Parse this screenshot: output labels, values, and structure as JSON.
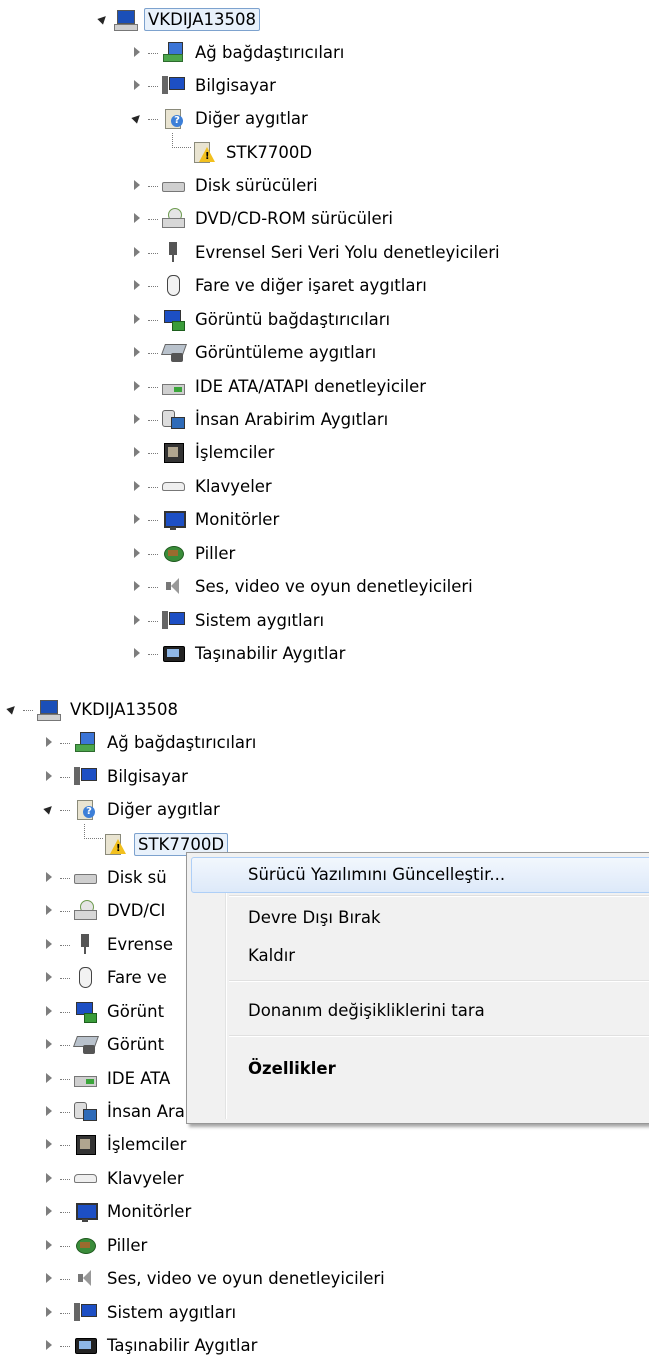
{
  "top_tree": {
    "root": "VKDIJA13508",
    "items": [
      {
        "label": "Ağ bağdaştırıcıları",
        "icon": "network-adapter-icon"
      },
      {
        "label": "Bilgisayar",
        "icon": "computer-icon"
      },
      {
        "label": "Diğer aygıtlar",
        "icon": "unknown-device-icon",
        "expanded": true
      },
      {
        "label": "STK7700D",
        "icon": "warning-device-icon",
        "child": true
      },
      {
        "label": "Disk sürücüleri",
        "icon": "disk-drive-icon"
      },
      {
        "label": "DVD/CD-ROM sürücüleri",
        "icon": "dvd-drive-icon"
      },
      {
        "label": "Evrensel Seri Veri Yolu denetleyicileri",
        "icon": "usb-icon"
      },
      {
        "label": "Fare ve diğer işaret aygıtları",
        "icon": "mouse-icon"
      },
      {
        "label": "Görüntü bağdaştırıcıları",
        "icon": "display-adapter-icon"
      },
      {
        "label": "Görüntüleme aygıtları",
        "icon": "imaging-device-icon"
      },
      {
        "label": "IDE ATA/ATAPI denetleyiciler",
        "icon": "ide-controller-icon"
      },
      {
        "label": "İnsan Arabirim Aygıtları",
        "icon": "hid-icon"
      },
      {
        "label": "İşlemciler",
        "icon": "processor-icon"
      },
      {
        "label": "Klavyeler",
        "icon": "keyboard-icon"
      },
      {
        "label": "Monitörler",
        "icon": "monitor-icon"
      },
      {
        "label": "Piller",
        "icon": "battery-icon"
      },
      {
        "label": "Ses, video ve oyun denetleyicileri",
        "icon": "sound-icon"
      },
      {
        "label": "Sistem aygıtları",
        "icon": "system-device-icon"
      },
      {
        "label": "Taşınabilir Aygıtlar",
        "icon": "portable-device-icon"
      }
    ]
  },
  "bottom_tree": {
    "root": "VKDIJA13508",
    "items": [
      {
        "label": "Ağ bağdaştırıcıları"
      },
      {
        "label": "Bilgisayar"
      },
      {
        "label": "Diğer aygıtlar"
      },
      {
        "label": "STK7700D"
      },
      {
        "label": "Disk sü"
      },
      {
        "label": "DVD/CI"
      },
      {
        "label": "Evrense"
      },
      {
        "label": "Fare ve"
      },
      {
        "label": "Görünt"
      },
      {
        "label": "Görünt"
      },
      {
        "label": "IDE ATA"
      },
      {
        "label": "İnsan Arabirim Aygıtları"
      },
      {
        "label": "İşlemciler"
      },
      {
        "label": "Klavyeler"
      },
      {
        "label": "Monitörler"
      },
      {
        "label": "Piller"
      },
      {
        "label": "Ses, video ve oyun denetleyicileri"
      },
      {
        "label": "Sistem aygıtları"
      },
      {
        "label": "Taşınabilir Aygıtlar"
      }
    ]
  },
  "context_menu": {
    "items": [
      {
        "label": "Sürücü Yazılımını Güncelleştir...",
        "highlighted": true
      },
      {
        "label": "Devre Dışı Bırak"
      },
      {
        "label": "Kaldır"
      },
      {
        "label": "Donanım değişikliklerini tara"
      },
      {
        "label": "Özellikler",
        "bold": true
      }
    ]
  }
}
